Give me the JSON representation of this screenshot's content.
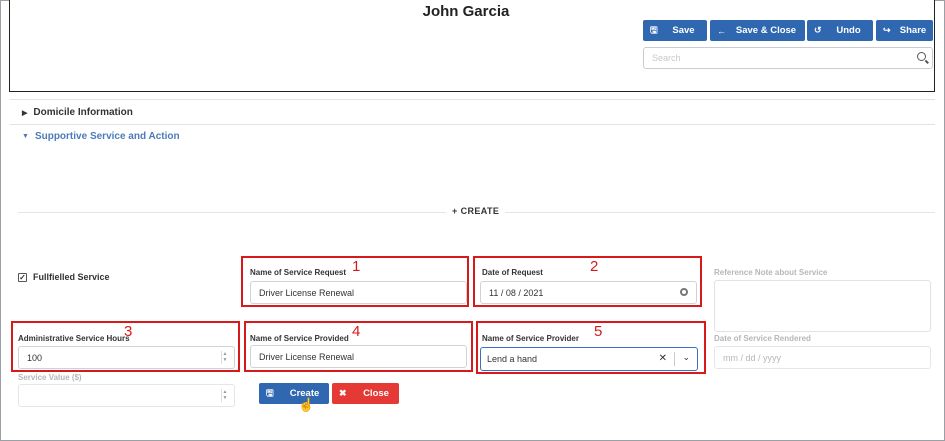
{
  "header": {
    "title": "John Garcia",
    "buttons": {
      "save": "Save",
      "save_close": "Save & Close",
      "undo": "Undo",
      "share": "Share"
    },
    "search_placeholder": "Search"
  },
  "sections": {
    "domicile": "Domicile Information",
    "supportive": "Supportive Service and Action"
  },
  "create_label": "CREATE",
  "form": {
    "fulfilled": {
      "label": "Fullfielled Service",
      "checked": true
    },
    "name_of_service_request": {
      "label": "Name of Service Request",
      "value": "Driver License Renewal"
    },
    "date_of_request": {
      "label": "Date of Request",
      "value": "11 / 08 / 2021"
    },
    "reference_note": {
      "label": "Reference Note about Service",
      "placeholder": ""
    },
    "admin_hours": {
      "label": "Administrative Service Hours",
      "value": "100"
    },
    "name_of_service_provided": {
      "label": "Name of Service Provided",
      "value": "Driver License Renewal"
    },
    "name_of_service_provider": {
      "label": "Name of Service Provider",
      "value": "Lend a hand"
    },
    "date_rendered": {
      "label": "Date of Service Rendered",
      "placeholder": "mm / dd / yyyy"
    },
    "service_value": {
      "label": "Service Value ($)",
      "value": ""
    }
  },
  "actions": {
    "create": "Create",
    "close": "Close"
  },
  "annotations": [
    "1",
    "2",
    "3",
    "4",
    "5"
  ],
  "colors": {
    "primary": "#2f67b1",
    "danger": "#e53935",
    "annotation": "#d7191c",
    "section_active": "#4d7bb8"
  }
}
